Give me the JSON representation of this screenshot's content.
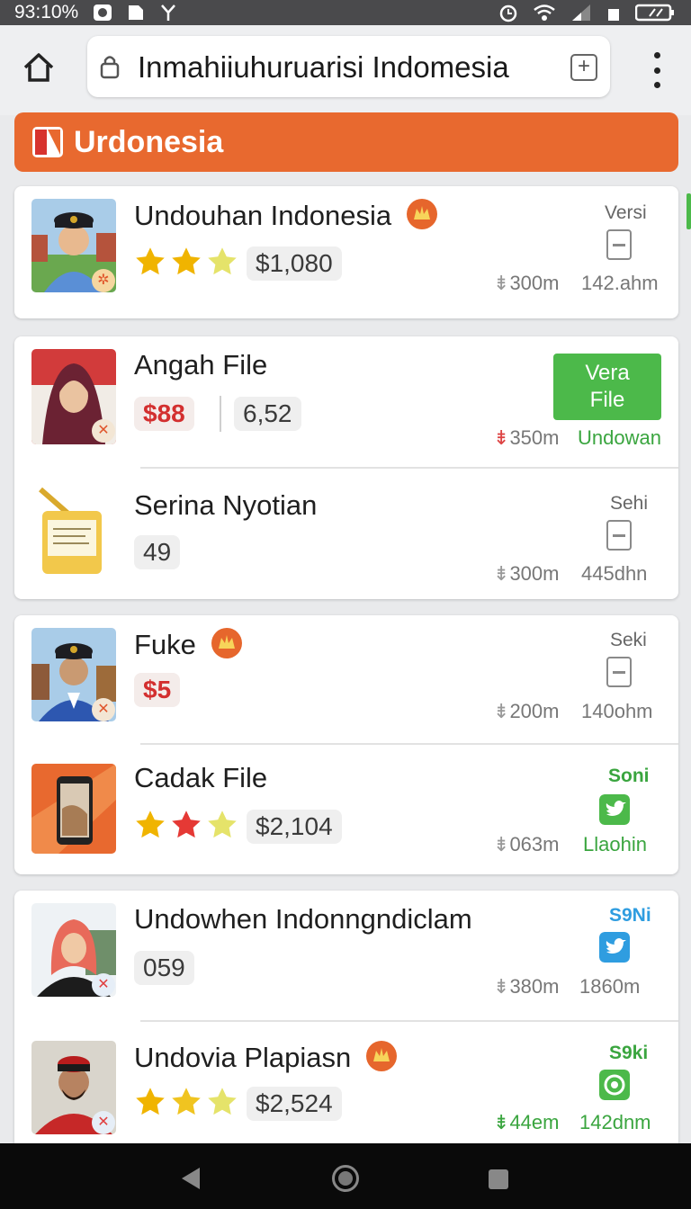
{
  "status_bar": {
    "time": "93:10%"
  },
  "browser": {
    "url": "Inmahiiuhuruarisi Indomesia",
    "tab_icon": "+"
  },
  "page": {
    "title": "Urdonesia"
  },
  "items": [
    {
      "title": "Undouhan Indonesia",
      "rating": 3,
      "price": "$1,080",
      "side_label": "Versi",
      "size": "300m",
      "info": "142.ahm"
    },
    {
      "title": "Angah File",
      "price": "$88",
      "price2": "6,52",
      "button_label": "Vera File",
      "size": "350m",
      "info": "Undowan"
    },
    {
      "title": "Serina Nyotian",
      "count": "49",
      "side_label": "Sehi",
      "size": "300m",
      "info": "445dhn"
    },
    {
      "title": "Fuke",
      "price": "$5",
      "side_label": "Seki",
      "size": "200m",
      "info": "140ohm"
    },
    {
      "title": "Cadak File",
      "rating": 3,
      "price": "$2,104",
      "side_label": "Soni",
      "size": "063m",
      "info": "Llaohin"
    },
    {
      "title": "Undowhen Indonngndiclam",
      "count": "059",
      "side_label": "S9Ni",
      "size": "380m",
      "info": "1860m"
    },
    {
      "title": "Undovia Plapiasn",
      "rating": 3,
      "price": "$2,524",
      "side_label": "S9ki",
      "size": "44em",
      "info": "142dnm"
    }
  ],
  "colors": {
    "accent": "#e8692f",
    "green": "#4cb94a",
    "red": "#d32f2f",
    "star": "#f0b400",
    "star_red": "#e53935"
  },
  "icons": {
    "download": "download-icon",
    "home": "home-icon",
    "lock": "lock-icon",
    "menu": "more-vert-icon"
  }
}
